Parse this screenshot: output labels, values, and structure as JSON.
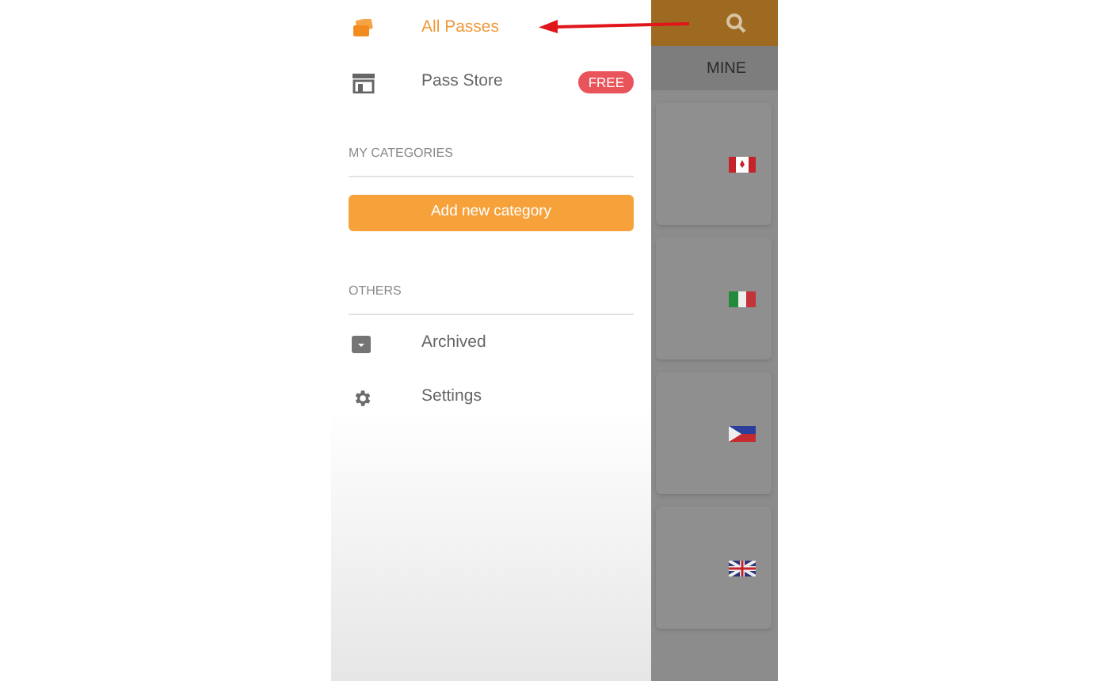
{
  "drawer": {
    "items": [
      {
        "label": "All Passes",
        "kind": "tickets",
        "selected": true
      },
      {
        "label": "Pass Store",
        "kind": "store",
        "selected": false,
        "badge": "FREE"
      }
    ],
    "categories_heading": "MY CATEGORIES",
    "add_button": "Add new category",
    "others_heading": "OTHERS",
    "others": [
      {
        "label": "Archived",
        "kind": "archive"
      },
      {
        "label": "Settings",
        "kind": "gear"
      }
    ]
  },
  "background_app": {
    "tab": "MINE",
    "cards": [
      {
        "kind": "canada"
      },
      {
        "kind": "italy"
      },
      {
        "kind": "philippines"
      },
      {
        "kind": "uk"
      }
    ]
  }
}
